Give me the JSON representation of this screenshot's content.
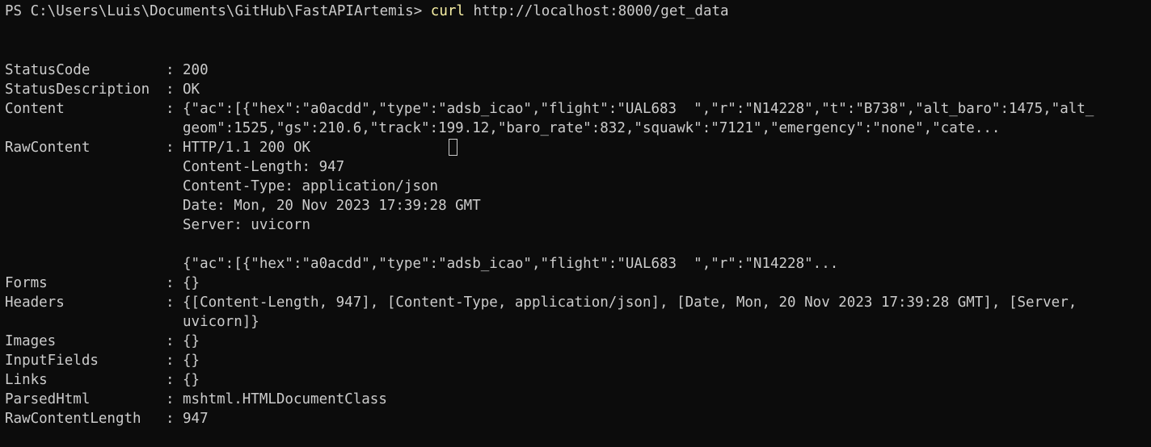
{
  "prompt": {
    "path": "PS C:\\Users\\Luis\\Documents\\GitHub\\FastAPIArtemis> ",
    "command": "curl",
    "args": " http://localhost:8000/get_data"
  },
  "response": {
    "status_code": {
      "key": "StatusCode",
      "value": "200"
    },
    "status_description": {
      "key": "StatusDescription",
      "value": "OK"
    },
    "content": {
      "key": "Content",
      "line1": "{\"ac\":[{\"hex\":\"a0acdd\",\"type\":\"adsb_icao\",\"flight\":\"UAL683  \",\"r\":\"N14228\",\"t\":\"B738\",\"alt_baro\":1475,\"alt_",
      "line2": "geom\":1525,\"gs\":210.6,\"track\":199.12,\"baro_rate\":832,\"squawk\":\"7121\",\"emergency\":\"none\",\"cate..."
    },
    "raw_content": {
      "key": "RawContent",
      "line1": "HTTP/1.1 200 OK",
      "line2": "Content-Length: 947",
      "line3": "Content-Type: application/json",
      "line4": "Date: Mon, 20 Nov 2023 17:39:28 GMT",
      "line5": "Server: uvicorn",
      "line6": "{\"ac\":[{\"hex\":\"a0acdd\",\"type\":\"adsb_icao\",\"flight\":\"UAL683  \",\"r\":\"N14228\"..."
    },
    "forms": {
      "key": "Forms",
      "value": "{}"
    },
    "headers": {
      "key": "Headers",
      "line1": "{[Content-Length, 947], [Content-Type, application/json], [Date, Mon, 20 Nov 2023 17:39:28 GMT], [Server,",
      "line2": "uvicorn]}"
    },
    "images": {
      "key": "Images",
      "value": "{}"
    },
    "input_fields": {
      "key": "InputFields",
      "value": "{}"
    },
    "links": {
      "key": "Links",
      "value": "{}"
    },
    "parsed_html": {
      "key": "ParsedHtml",
      "value": "mshtml.HTMLDocumentClass"
    },
    "raw_content_length": {
      "key": "RawContentLength",
      "value": "947"
    }
  },
  "colors": {
    "background": "#0c0c0c",
    "foreground": "#cccccc",
    "command": "#f9f1a5"
  }
}
